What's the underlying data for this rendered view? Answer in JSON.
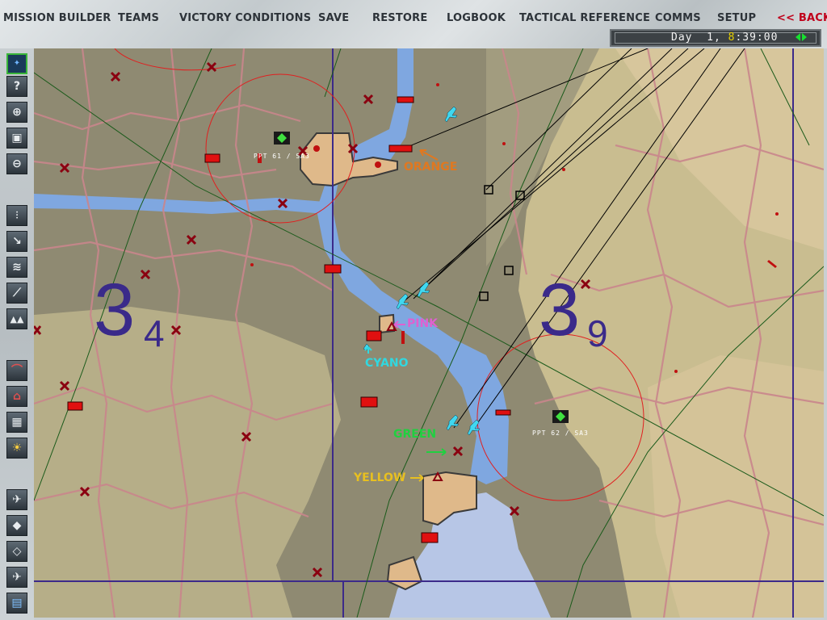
{
  "menu": {
    "mission_builder": "MISSION BUILDER",
    "teams": "TEAMS",
    "victory_conditions": "VICTORY CONDITIONS",
    "save": "SAVE",
    "restore": "RESTORE",
    "logbook": "LOGBOOK",
    "tactical_reference": "TACTICAL REFERENCE",
    "comms": "COMMS",
    "setup": "SETUP",
    "back": "<< BACK"
  },
  "clock": {
    "day_label": "Day",
    "day": "1,",
    "hour": "8",
    "time_rest": ":39:00"
  },
  "toolbar": {
    "icons": [
      "flag-icon",
      "help-icon",
      "zoom-in-icon",
      "zoom-fit-icon",
      "zoom-out-icon",
      "altitude-icon",
      "path-icon",
      "threat-rings-icon",
      "radar-icon",
      "terrain-icon",
      "sam-range-icon",
      "sam-range-alt-icon",
      "airbase-icon",
      "weather-icon",
      "aircraft-icon",
      "ground-unit-icon",
      "navaid-icon",
      "package-icon",
      "filter-icon"
    ]
  },
  "map": {
    "sectors": [
      {
        "big": "3",
        "small": "4"
      },
      {
        "big": "3",
        "small": "9"
      }
    ],
    "flight_labels": {
      "orange": "ORANGE",
      "pink": "PINK",
      "cyano": "CYANO",
      "green": "GREEN",
      "yellow": "YELLOW"
    },
    "ppt_labels": [
      "PPT 61 / SA3",
      "PPT 62 / SA3"
    ],
    "colors": {
      "terrain_dark": "#8f8a72",
      "terrain_light": "#c9bd90",
      "water": "#7fa7e0",
      "water_light": "#b7c6e6",
      "border_lines": "#c9868c",
      "grid_lines": "#3c2a8a",
      "threat_ring": "#e02020",
      "flight_path": "#000000",
      "aircraft": "#40d8f0",
      "orange": "#e07820",
      "pink": "#e060d0",
      "cyano": "#30d8e0",
      "green": "#20d040",
      "yellow": "#e8c020"
    }
  }
}
